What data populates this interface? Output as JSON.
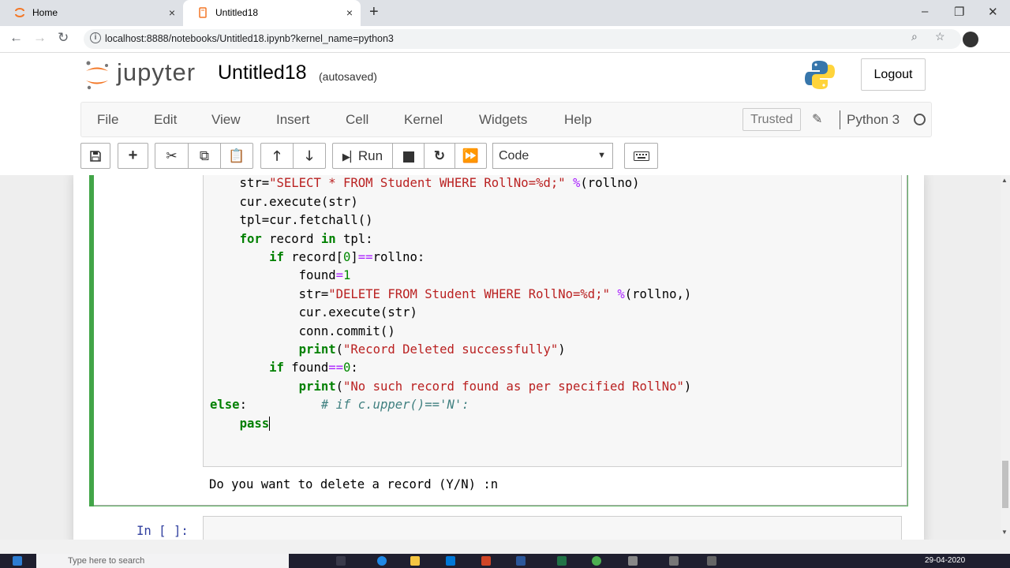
{
  "browser": {
    "tabs": [
      {
        "label": "Home",
        "close": "×"
      },
      {
        "label": "Untitled18",
        "close": "×"
      }
    ],
    "new_tab": "+",
    "window_controls": {
      "minimize": "–",
      "maximize": "❐",
      "close": "✕"
    },
    "url": "localhost:8888/notebooks/Untitled18.ipynb?kernel_name=python3",
    "nav": {
      "back": "←",
      "forward": "→",
      "reload": "↻"
    }
  },
  "header": {
    "logo_text": "jupyter",
    "notebook_title": "Untitled18",
    "autosave_status": "(autosaved)",
    "logout_label": "Logout"
  },
  "menu": {
    "items": [
      "File",
      "Edit",
      "View",
      "Insert",
      "Cell",
      "Kernel",
      "Widgets",
      "Help"
    ],
    "trusted_label": "Trusted",
    "kernel_name": "Python 3"
  },
  "toolbar": {
    "run_label": "Run",
    "cell_type": "Code"
  },
  "notebook": {
    "output_text": "Do you want to delete a record (Y/N) :n",
    "next_prompt": "In [ ]:"
  },
  "taskbar": {
    "search_placeholder": "Type here to search",
    "date": "29-04-2020"
  },
  "colors": {
    "selected_cell": "#42a548",
    "keyword": "#008000",
    "string": "#ba2121",
    "operator": "#aa22ff",
    "comment": "#408080",
    "prompt": "#303f9f"
  }
}
